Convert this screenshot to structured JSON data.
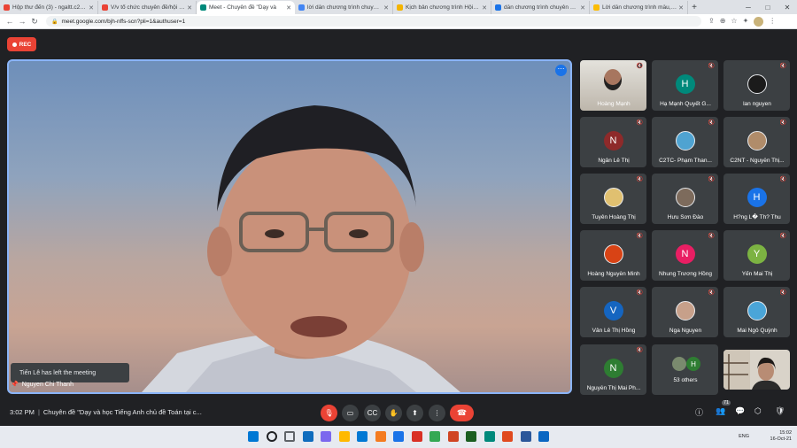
{
  "browser": {
    "tabs": [
      {
        "title": "Hộp thư đến (3) - ngaltt.c2gvt",
        "color": "#ea4335"
      },
      {
        "title": "V/v tổ chức chuyên đề/hội thảo",
        "color": "#ea4335"
      },
      {
        "title": "Meet - Chuyên đề \"Dạy và",
        "color": "#00897b",
        "active": true
      },
      {
        "title": "lời dẫn chương trình chuyên đề",
        "color": "#4285f4"
      },
      {
        "title": "Kịch bản chương trình Hội nghị",
        "color": "#f4b400"
      },
      {
        "title": "dẫn chương trình chuyên đề - G",
        "color": "#1a73e8"
      },
      {
        "title": "Lời dẫn chương trình mẫu, đọc",
        "color": "#fbbc04"
      }
    ],
    "url": "meet.google.com/bjh-nffs-scn?pli=1&authuser=1"
  },
  "meet": {
    "rec_label": "REC",
    "toast": "Tiến Lê has left the meeting",
    "main_speaker": "Nguyen Chi Thanh",
    "time": "3:02 PM",
    "meeting_title": "Chuyên đề \"Dạy và học Tiếng Anh chủ đề Toán tại c...",
    "participants_count": "71",
    "others_label": "53 others",
    "participants": [
      {
        "name": "Hoàng Mạnh",
        "initial": "",
        "color": "#6b5b4b",
        "photo": true
      },
      {
        "name": "Hạ Mạnh Quyết G...",
        "initial": "H",
        "color": "#00897b"
      },
      {
        "name": "lan nguyen",
        "initial": "",
        "color": "#1b1b1b",
        "photo": true
      },
      {
        "name": "Ngân Lê Thị",
        "initial": "N",
        "color": "#8e2a2a"
      },
      {
        "name": "C2TC- Phạm Than...",
        "initial": "",
        "color": "#4fa3d1",
        "photo": true
      },
      {
        "name": "C2NT - Nguyễn Thị...",
        "initial": "",
        "color": "#b08c6a",
        "photo": true
      },
      {
        "name": "Tuyên Hoàng Thị",
        "initial": "",
        "color": "#e0c070",
        "photo": true
      },
      {
        "name": "Hưu Sơn Đào",
        "initial": "",
        "color": "#7d6b5c",
        "photo": true
      },
      {
        "name": "H?ng L� Th? Thu",
        "initial": "H",
        "color": "#1a73e8"
      },
      {
        "name": "Hoàng Nguyễn Minh",
        "initial": "",
        "color": "#d84315",
        "photo": true
      },
      {
        "name": "Nhung Trương Hồng",
        "initial": "N",
        "color": "#e91e63"
      },
      {
        "name": "Yến Mai Thị",
        "initial": "Y",
        "color": "#7cb342"
      },
      {
        "name": "Vân Lê Thị Hồng",
        "initial": "V",
        "color": "#1565c0"
      },
      {
        "name": "Nga Nguyen",
        "initial": "",
        "color": "#c7a08a",
        "photo": true
      },
      {
        "name": "Mai Ngô Quỳnh",
        "initial": "",
        "color": "#4aa5d8",
        "photo": true
      },
      {
        "name": "Nguyễn Thị Mai Ph...",
        "initial": "N",
        "color": "#2e7d32"
      }
    ]
  },
  "taskbar": {
    "lang": "ENG",
    "clock": "15:02",
    "date": "16-Oct-21"
  }
}
